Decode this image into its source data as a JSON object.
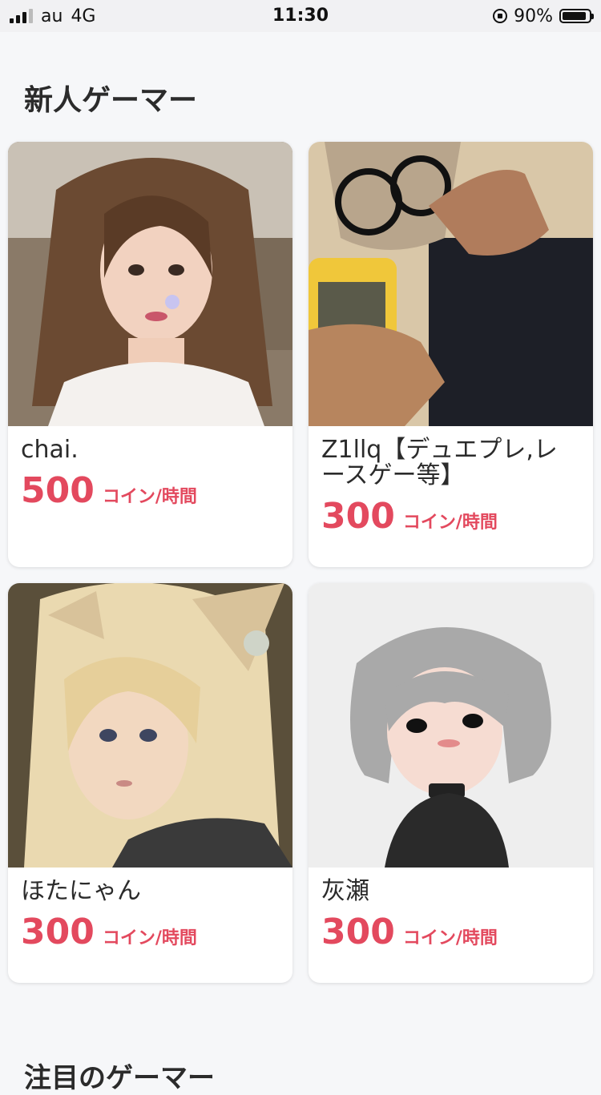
{
  "status_bar": {
    "carrier": "au",
    "network": "4G",
    "time": "11:30",
    "battery": "90%"
  },
  "section": {
    "title": "新人ゲーマー"
  },
  "gamers": [
    {
      "name": "chai.",
      "price": "500",
      "unit": "コイン/時間",
      "image": "portrait-woman-brown-hair"
    },
    {
      "name": "Z1llq【デュエプレ,レースゲー等】",
      "price": "300",
      "unit": "コイン/時間",
      "image": "portrait-man-glasses-peace-sign"
    },
    {
      "name": "ほたにゃん",
      "price": "300",
      "unit": "コイン/時間",
      "image": "game-avatar-blonde-cat-ears"
    },
    {
      "name": "灰瀬",
      "price": "300",
      "unit": "コイン/時間",
      "image": "illustration-gray-hair-girl"
    }
  ],
  "next_section": {
    "title": "注目のゲーマー"
  }
}
